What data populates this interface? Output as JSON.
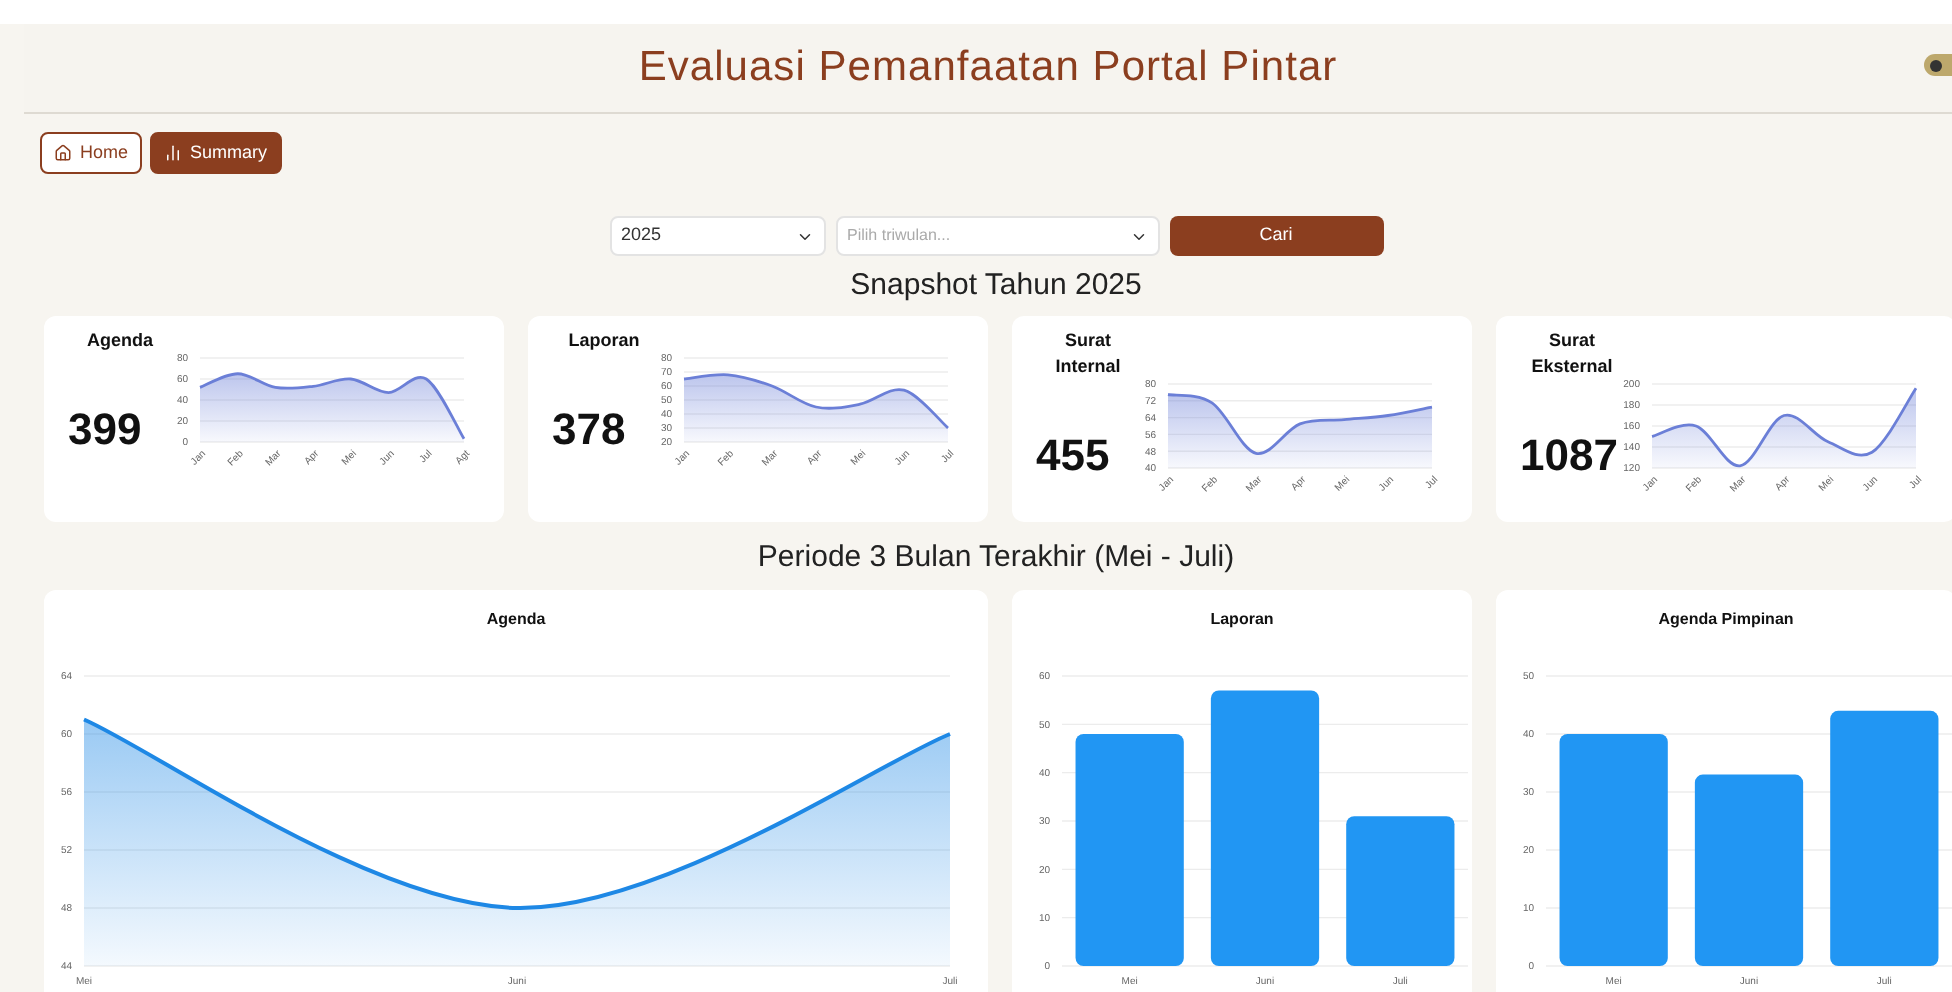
{
  "header": {
    "title": "Evaluasi Pemanfaatan Portal Pintar"
  },
  "nav": [
    {
      "label": "Home",
      "selected": false
    },
    {
      "label": "Summary",
      "selected": true
    }
  ],
  "filters": {
    "year": {
      "value": "2025"
    },
    "quarter": {
      "placeholder": "Pilih triwulan..."
    },
    "button": "Cari"
  },
  "snapshot": {
    "title": "Snapshot Tahun 2025",
    "cards": [
      {
        "title": "Agenda",
        "total": "399",
        "chart_data": {
          "type": "area",
          "categories": [
            "Jan",
            "Feb",
            "Mar",
            "Apr",
            "Mei",
            "Jun",
            "Jul",
            "Agt"
          ],
          "series": [
            {
              "color": "#6b7fd7",
              "values": [
                52,
                65,
                52,
                53,
                60,
                47,
                60,
                3
              ]
            }
          ],
          "grid": true,
          "ylim": [
            0,
            80
          ],
          "yticks": [
            0,
            20,
            40,
            60,
            80
          ]
        }
      },
      {
        "title": "Laporan",
        "total": "378",
        "chart_data": {
          "type": "area",
          "categories": [
            "Jan",
            "Feb",
            "Mar",
            "Apr",
            "Mei",
            "Jun",
            "Jul"
          ],
          "series": [
            {
              "color": "#6b7fd7",
              "values": [
                65,
                68,
                60,
                45,
                47,
                57,
                30
              ]
            }
          ],
          "grid": true,
          "ylim": [
            20,
            80
          ],
          "yticks": [
            20,
            30,
            40,
            50,
            60,
            70,
            80
          ]
        }
      },
      {
        "title": "Surat Internal",
        "total": "455",
        "chart_data": {
          "type": "area",
          "categories": [
            "Jan",
            "Feb",
            "Mar",
            "Apr",
            "Mei",
            "Jun",
            "Jul"
          ],
          "series": [
            {
              "color": "#6b7fd7",
              "values": [
                75,
                71,
                47,
                61,
                63,
                65,
                69
              ]
            }
          ],
          "grid": true,
          "ylim": [
            40,
            80
          ],
          "yticks": [
            40,
            48,
            56,
            64,
            72,
            80
          ]
        }
      },
      {
        "title": "Surat Eksternal",
        "total": "1087",
        "chart_data": {
          "type": "area",
          "categories": [
            "Jan",
            "Feb",
            "Mar",
            "Apr",
            "Mei",
            "Jun",
            "Jul"
          ],
          "series": [
            {
              "color": "#6b7fd7",
              "values": [
                150,
                160,
                122,
                170,
                145,
                135,
                196
              ]
            }
          ],
          "grid": true,
          "ylim": [
            120,
            200
          ],
          "yticks": [
            120,
            140,
            160,
            180,
            200
          ]
        }
      }
    ]
  },
  "recent": {
    "title": "Periode 3 Bulan Terakhir (Mei - Juli)",
    "cards": [
      {
        "title": "Agenda",
        "chart_data": {
          "type": "area",
          "categories": [
            "Mei",
            "Juni",
            "Juli"
          ],
          "series": [
            {
              "color": "#1e88e5",
              "values": [
                61,
                48,
                60
              ]
            }
          ],
          "grid": true,
          "ylim": [
            44,
            64
          ],
          "yticks": [
            44,
            48,
            52,
            56,
            60,
            64
          ]
        }
      },
      {
        "title": "Laporan",
        "chart_data": {
          "type": "bar",
          "categories": [
            "Mei",
            "Juni",
            "Juli"
          ],
          "series": [
            {
              "color": "#2196f3",
              "values": [
                48,
                57,
                31
              ]
            }
          ],
          "grid": true,
          "ylim": [
            0,
            60
          ],
          "yticks": [
            0,
            10,
            20,
            30,
            40,
            50,
            60
          ]
        }
      },
      {
        "title": "Agenda Pimpinan",
        "chart_data": {
          "type": "bar",
          "categories": [
            "Mei",
            "Juni",
            "Juli"
          ],
          "series": [
            {
              "color": "#2196f3",
              "values": [
                40,
                33,
                44
              ]
            }
          ],
          "grid": true,
          "ylim": [
            0,
            50
          ],
          "yticks": [
            0,
            10,
            20,
            30,
            40,
            50
          ]
        }
      }
    ]
  }
}
